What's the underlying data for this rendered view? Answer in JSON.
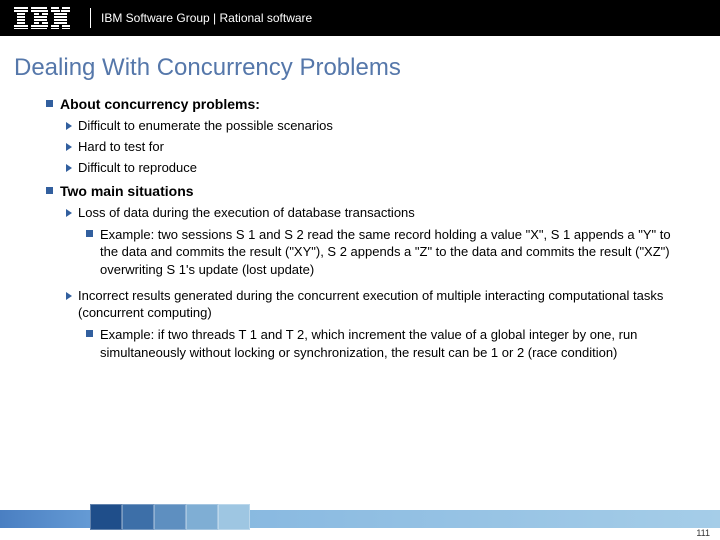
{
  "header": {
    "breadcrumb": "IBM Software Group | Rational software"
  },
  "title": "Dealing With Concurrency Problems",
  "section1": {
    "heading": "About concurrency problems:",
    "items": [
      "Difficult to enumerate the possible scenarios",
      "Hard to test for",
      "Difficult to reproduce"
    ]
  },
  "section2": {
    "heading": "Two main situations",
    "item1": "Loss of data during the execution of database transactions",
    "example1": "Example: two sessions S 1 and S 2 read the same record holding a value \"X\", S 1 appends a \"Y\" to the data and commits the result (\"XY\"), S 2 appends a \"Z\" to the data and commits the result (\"XZ\") overwriting S 1's update (lost update)",
    "item2": "Incorrect results generated during the concurrent execution of multiple interacting computational tasks (concurrent computing)",
    "example2": "Example: if two threads T 1 and T 2, which increment the value of a global integer by one, run simultaneously without locking or synchronization, the result can be 1 or 2 (race condition)"
  },
  "page": "111"
}
